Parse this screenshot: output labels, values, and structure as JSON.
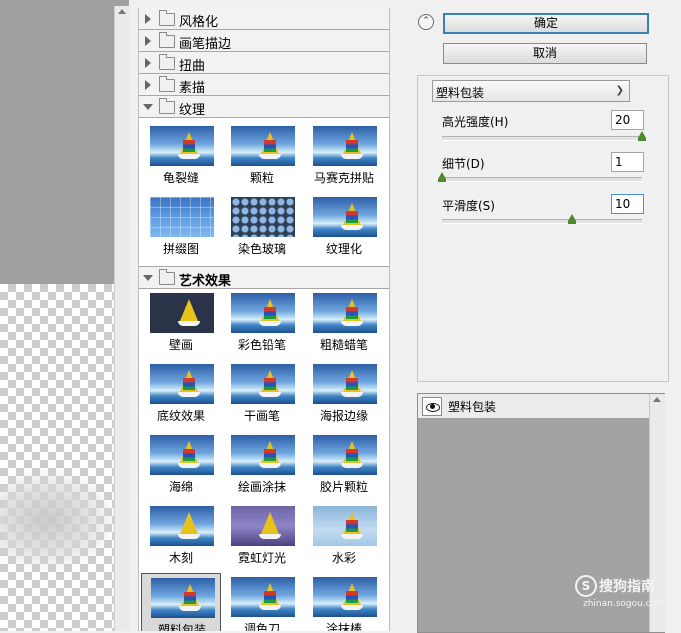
{
  "filter_gallery": {
    "categories_collapsed": [
      "风格化",
      "画笔描边",
      "扭曲",
      "素描"
    ],
    "texture": {
      "name": "纹理",
      "filters": [
        "龟裂缝",
        "颗粒",
        "马赛克拼贴",
        "拼缀图",
        "染色玻璃",
        "纹理化"
      ]
    },
    "artistic": {
      "name": "艺术效果",
      "filters": [
        "壁画",
        "彩色铅笔",
        "粗糙蜡笔",
        "底纹效果",
        "干画笔",
        "海报边缘",
        "海绵",
        "绘画涂抹",
        "胶片颗粒",
        "木刻",
        "霓虹灯光",
        "水彩",
        "塑料包装",
        "调色刀",
        "涂抹棒"
      ],
      "selected": "塑料包装"
    }
  },
  "buttons": {
    "ok": "确定",
    "cancel": "取消"
  },
  "settings": {
    "filter_select": "塑料包装",
    "params": [
      {
        "label": "高光强度(H)",
        "value": "20",
        "slider": 1.0
      },
      {
        "label": "细节(D)",
        "value": "1",
        "slider": 0.0
      },
      {
        "label": "平滑度(S)",
        "value": "10",
        "slider": 0.65
      }
    ]
  },
  "effect_layer": {
    "name": "塑料包装"
  },
  "watermark": {
    "icon": "S",
    "text": "搜狗指南",
    "url": "zhinan.sogou.com"
  },
  "colors": {
    "selection_border": "#3c7fb1",
    "slider_thumb": "#4f8a2e"
  }
}
